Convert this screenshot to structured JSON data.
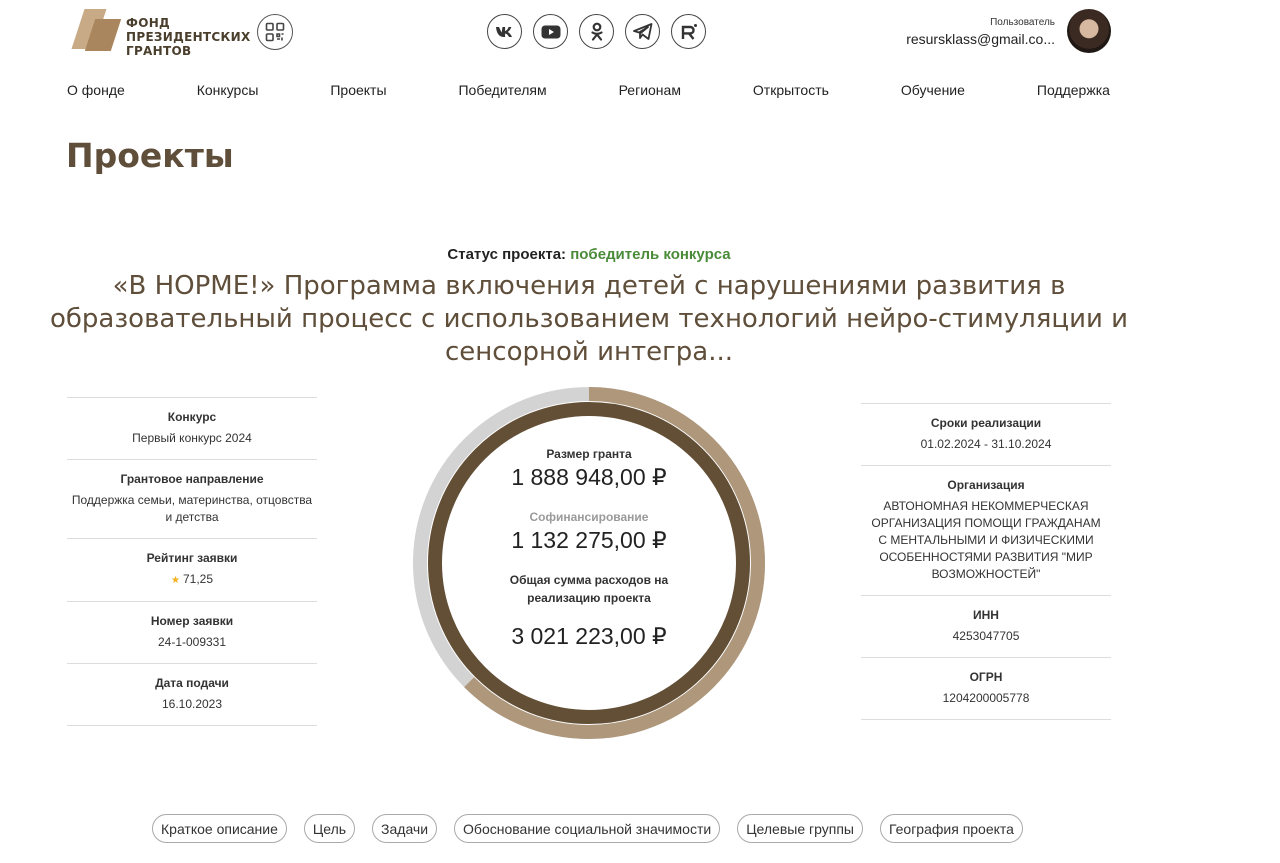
{
  "header": {
    "logo_lines": [
      "ФОНД",
      "ПРЕЗИДЕНТСКИХ",
      "ГРАНТОВ"
    ],
    "social_icons": [
      "vk-icon",
      "youtube-icon",
      "odnoklassniki-icon",
      "telegram-icon",
      "rutube-icon"
    ],
    "user_label": "Пользователь",
    "user_email": "resursklass@gmail.co..."
  },
  "nav": [
    "О фонде",
    "Конкурсы",
    "Проекты",
    "Победителям",
    "Регионам",
    "Открытость",
    "Обучение",
    "Поддержка"
  ],
  "page_title": "Проекты",
  "status": {
    "label": "Статус проекта:",
    "value": "победитель конкурса",
    "value_color": "#4a8b3a"
  },
  "project_title": "«В НОРМЕ!» Программа включения детей с нарушениями развития в образовательный процесс с использованием технологий нейро-стимуляции и сенсорной интегра...",
  "left_info": [
    {
      "label": "Конкурс",
      "value": "Первый конкурс 2024"
    },
    {
      "label": "Грантовое направление",
      "value": "Поддержка семьи, материнства, отцовства и детства"
    },
    {
      "label": "Рейтинг заявки",
      "value": "71,25"
    },
    {
      "label": "Номер заявки",
      "value": "24-1-009331"
    },
    {
      "label": "Дата подачи",
      "value": "16.10.2023"
    }
  ],
  "right_info": [
    {
      "label": "Сроки реализации",
      "value": "01.02.2024 - 31.10.2024"
    },
    {
      "label": "Организация",
      "value": "АВТОНОМНАЯ НЕКОММЕРЧЕСКАЯ ОРГАНИЗАЦИЯ ПОМОЩИ ГРАЖДАНАМ С МЕНТАЛЬНЫМИ И ФИЗИЧЕСКИМИ ОСОБЕННОСТЯМИ РАЗВИТИЯ \"МИР ВОЗМОЖНОСТЕЙ\""
    },
    {
      "label": "ИНН",
      "value": "4253047705"
    },
    {
      "label": "ОГРН",
      "value": "1204200005778"
    }
  ],
  "finance": {
    "grant_label": "Размер гранта",
    "grant_value": "1 888 948,00 ₽",
    "cofinance_label": "Софинансирование",
    "cofinance_value": "1 132 275,00 ₽",
    "total_label": "Общая сумма расходов на реализацию проекта",
    "total_value": "3 021 223,00 ₽",
    "grant_amount": 1888948.0,
    "cofinance_amount": 1132275.0,
    "total_amount": 3021223.0,
    "colors": {
      "outer_fill": "#ae977a",
      "outer_rest": "#d3d3d3",
      "inner": "#634f36"
    }
  },
  "tabs": [
    "Краткое описание",
    "Цель",
    "Задачи",
    "Обоснование социальной значимости",
    "Целевые группы",
    "География проекта"
  ]
}
